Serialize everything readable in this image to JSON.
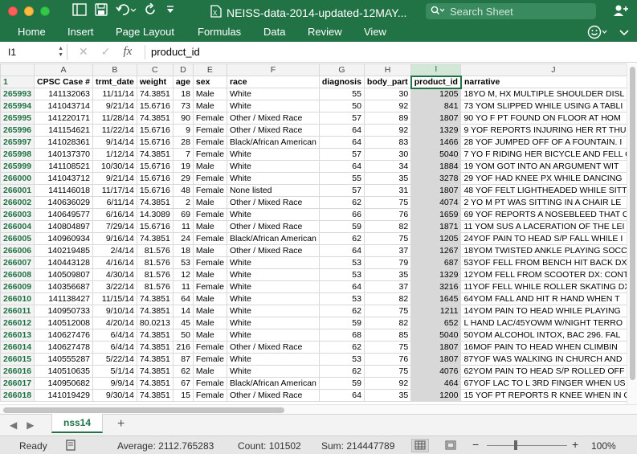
{
  "window": {
    "title": "NEISS-data-2014-updated-12MAY...",
    "search_placeholder": "Search Sheet",
    "accent": "#217346"
  },
  "ribbon": {
    "tabs": [
      "Home",
      "Insert",
      "Page Layout",
      "Formulas",
      "Data",
      "Review",
      "View"
    ]
  },
  "formula_bar": {
    "name_box": "I1",
    "value": "product_id"
  },
  "columns": [
    "A",
    "B",
    "C",
    "D",
    "E",
    "F",
    "G",
    "H",
    "I",
    "J",
    "K",
    "L"
  ],
  "selected_column": "I",
  "header_row": {
    "row_number": "1",
    "cells": [
      "CPSC Case #",
      "trmt_date",
      "weight",
      "age",
      "sex",
      "race",
      "diagnosis",
      "body_part",
      "product_id",
      "narrative",
      "",
      ""
    ]
  },
  "rows": [
    {
      "n": "265993",
      "cells": [
        "141132063",
        "11/11/14",
        "74.3851",
        "18",
        "Male",
        "White",
        "55",
        "30",
        "1205",
        "18YO M, HX MULTIPLE SHOULDER DISL",
        "",
        ""
      ]
    },
    {
      "n": "265994",
      "cells": [
        "141043714",
        "9/21/14",
        "15.6716",
        "73",
        "Male",
        "White",
        "50",
        "92",
        "841",
        "73 YOM SLIPPED WHILE USING A TABLI",
        "",
        ""
      ]
    },
    {
      "n": "265995",
      "cells": [
        "141220171",
        "11/28/14",
        "74.3851",
        "90",
        "Female",
        "Other / Mixed Race",
        "57",
        "89",
        "1807",
        "90 YO F PT FOUND ON FLOOR AT HOM",
        "",
        ""
      ]
    },
    {
      "n": "265996",
      "cells": [
        "141154621",
        "11/22/14",
        "15.6716",
        "9",
        "Female",
        "Other / Mixed Race",
        "64",
        "92",
        "1329",
        "9 YOF REPORTS INJURING HER RT THUI",
        "",
        ""
      ]
    },
    {
      "n": "265997",
      "cells": [
        "141028361",
        "9/14/14",
        "15.6716",
        "28",
        "Female",
        "Black/African American",
        "64",
        "83",
        "1466",
        "28 YOF JUMPED OFF OF A FOUNTAIN. I",
        "",
        ""
      ]
    },
    {
      "n": "265998",
      "cells": [
        "140137370",
        "1/12/14",
        "74.3851",
        "7",
        "Female",
        "White",
        "57",
        "30",
        "5040",
        "7 YO F RIDING HER BICYCLE AND FELL C",
        "",
        ""
      ]
    },
    {
      "n": "265999",
      "cells": [
        "141108521",
        "10/30/14",
        "15.6716",
        "19",
        "Male",
        "White",
        "64",
        "34",
        "1884",
        "19 YOM GOT INTO AN ARGUMENT WIT",
        "",
        ""
      ]
    },
    {
      "n": "266000",
      "cells": [
        "141043712",
        "9/21/14",
        "15.6716",
        "29",
        "Female",
        "White",
        "55",
        "35",
        "3278",
        "29 YOF HAD KNEE PX WHILE DANCING",
        "",
        ""
      ]
    },
    {
      "n": "266001",
      "cells": [
        "141146018",
        "11/17/14",
        "15.6716",
        "48",
        "Female",
        "None listed",
        "57",
        "31",
        "1807",
        "48 YOF FELT LIGHTHEADED WHILE SITT",
        "",
        ""
      ]
    },
    {
      "n": "266002",
      "cells": [
        "140636029",
        "6/11/14",
        "74.3851",
        "2",
        "Male",
        "Other / Mixed Race",
        "62",
        "75",
        "4074",
        "2 YO M PT WAS SITTING IN A CHAIR LE",
        "",
        ""
      ]
    },
    {
      "n": "266003",
      "cells": [
        "140649577",
        "6/16/14",
        "14.3089",
        "69",
        "Female",
        "White",
        "66",
        "76",
        "1659",
        "69 YOF REPORTS A NOSEBLEED THAT C",
        "",
        ""
      ]
    },
    {
      "n": "266004",
      "cells": [
        "140804897",
        "7/29/14",
        "15.6716",
        "11",
        "Male",
        "Other / Mixed Race",
        "59",
        "82",
        "1871",
        "11 YOM SUS A LACERATION OF THE LEI",
        "",
        ""
      ]
    },
    {
      "n": "266005",
      "cells": [
        "140960934",
        "9/16/14",
        "74.3851",
        "24",
        "Female",
        "Black/African American",
        "62",
        "75",
        "1205",
        "24YOF PAIN TO HEAD S/P FALL WHILE I",
        "",
        ""
      ]
    },
    {
      "n": "266006",
      "cells": [
        "140219485",
        "2/4/14",
        "81.576",
        "18",
        "Male",
        "Other / Mixed Race",
        "64",
        "37",
        "1267",
        "18YOM TWISTED ANKLE PLAYING SOCC",
        "",
        ""
      ]
    },
    {
      "n": "266007",
      "cells": [
        "140443128",
        "4/16/14",
        "81.576",
        "53",
        "Female",
        "White",
        "53",
        "79",
        "687",
        "53YOF FELL FROM BENCH HIT BACK DX",
        "",
        ""
      ]
    },
    {
      "n": "266008",
      "cells": [
        "140509807",
        "4/30/14",
        "81.576",
        "12",
        "Male",
        "White",
        "53",
        "35",
        "1329",
        "12YOM FELL FROM SCOOTER DX: CONT",
        "",
        ""
      ]
    },
    {
      "n": "266009",
      "cells": [
        "140356687",
        "3/22/14",
        "81.576",
        "11",
        "Female",
        "White",
        "64",
        "37",
        "3216",
        "11YOF FELL WHILE ROLLER SKATING DX",
        "",
        ""
      ]
    },
    {
      "n": "266010",
      "cells": [
        "141138427",
        "11/15/14",
        "74.3851",
        "64",
        "Male",
        "White",
        "53",
        "82",
        "1645",
        "64YOM FALL AND HIT R HAND WHEN T",
        "",
        ""
      ]
    },
    {
      "n": "266011",
      "cells": [
        "140950733",
        "9/10/14",
        "74.3851",
        "14",
        "Male",
        "White",
        "62",
        "75",
        "1211",
        "14YOM PAIN TO HEAD WHILE PLAYING",
        "",
        ""
      ]
    },
    {
      "n": "266012",
      "cells": [
        "140512008",
        "4/20/14",
        "80.0213",
        "45",
        "Male",
        "White",
        "59",
        "82",
        "652",
        "L HAND LAC/45YOWM W/NIGHT TERRO",
        "",
        ""
      ]
    },
    {
      "n": "266013",
      "cells": [
        "140627476",
        "6/4/14",
        "74.3851",
        "50",
        "Male",
        "White",
        "68",
        "85",
        "5040",
        "50YOM ALCOHOL INTOX, BAC 296. FAL",
        "",
        ""
      ]
    },
    {
      "n": "266014",
      "cells": [
        "140627478",
        "6/4/14",
        "74.3851",
        "216",
        "Female",
        "Other / Mixed Race",
        "62",
        "75",
        "1807",
        "16MOF PAIN TO HEAD WHEN CLIMBIN",
        "",
        ""
      ]
    },
    {
      "n": "266015",
      "cells": [
        "140555287",
        "5/22/14",
        "74.3851",
        "87",
        "Female",
        "White",
        "53",
        "76",
        "1807",
        "87YOF WAS WALKING IN CHURCH AND",
        "",
        ""
      ]
    },
    {
      "n": "266016",
      "cells": [
        "140510635",
        "5/1/14",
        "74.3851",
        "62",
        "Male",
        "White",
        "62",
        "75",
        "4076",
        "62YOM PAIN TO HEAD S/P ROLLED OFF",
        "",
        ""
      ]
    },
    {
      "n": "266017",
      "cells": [
        "140950682",
        "9/9/14",
        "74.3851",
        "67",
        "Female",
        "Black/African American",
        "59",
        "92",
        "464",
        "67YOF LAC TO L 3RD FINGER WHEN US",
        "",
        ""
      ]
    },
    {
      "n": "266018",
      "cells": [
        "141019429",
        "9/30/14",
        "74.3851",
        "15",
        "Female",
        "Other / Mixed Race",
        "64",
        "35",
        "1200",
        "15 YOF PT REPORTS R KNEE WHEN IN GYM",
        "",
        ""
      ]
    }
  ],
  "sheet_tabs": {
    "active": "nss14",
    "add": "+"
  },
  "status": {
    "ready": "Ready",
    "average": "Average: 2112.765283",
    "count": "Count: 101502",
    "sum": "Sum: 214447789",
    "zoom": "100%",
    "zoom_minus": "−",
    "zoom_plus": "+"
  }
}
